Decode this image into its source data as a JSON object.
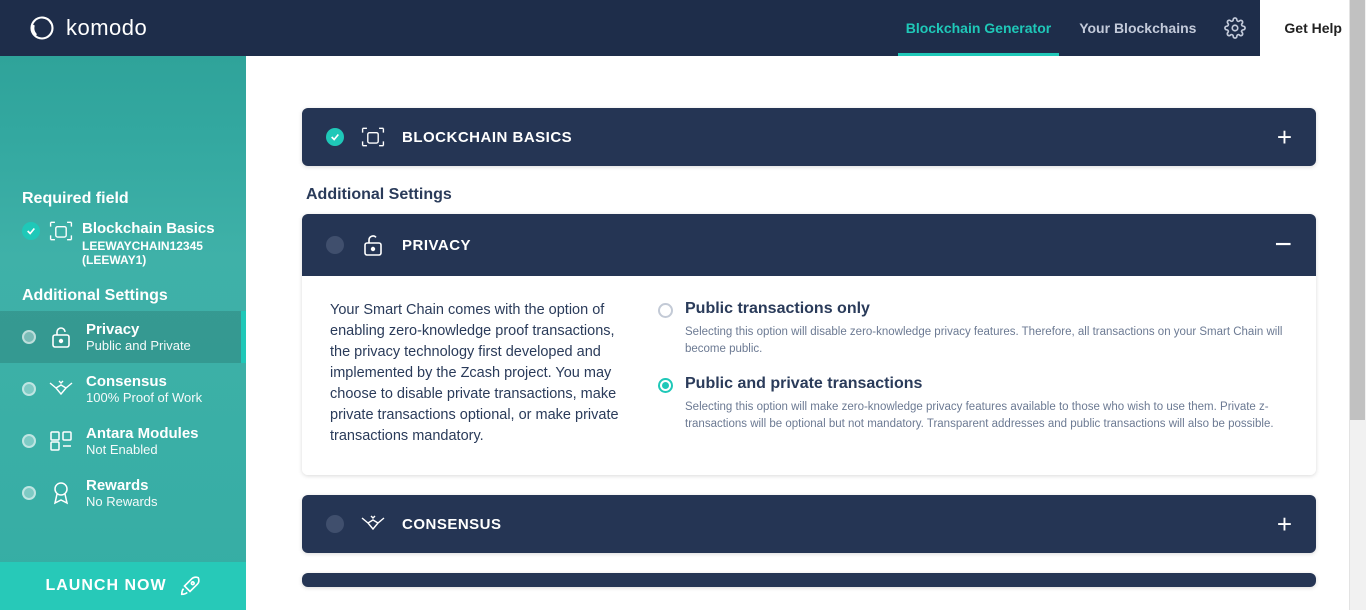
{
  "brand": "komodo",
  "topnav": {
    "generator": "Blockchain Generator",
    "your": "Your Blockchains",
    "help": "Get Help"
  },
  "sidebar": {
    "required_label": "Required field",
    "basics": {
      "title": "Blockchain Basics",
      "subtitle": "LEEWAYCHAIN12345 (LEEWAY1)"
    },
    "additional_label": "Additional Settings",
    "items": [
      {
        "title": "Privacy",
        "subtitle": "Public and Private"
      },
      {
        "title": "Consensus",
        "subtitle": "100% Proof of Work"
      },
      {
        "title": "Antara Modules",
        "subtitle": "Not Enabled"
      },
      {
        "title": "Rewards",
        "subtitle": "No Rewards"
      }
    ],
    "launch": "LAUNCH NOW"
  },
  "accordions": {
    "basics_title": "BLOCKCHAIN BASICS",
    "additional_label": "Additional Settings",
    "privacy": {
      "title": "PRIVACY",
      "description": "Your Smart Chain comes with the option of enabling zero-knowledge proof transactions, the privacy technology first developed and implemented by the Zcash project. You may choose to disable private transactions, make private transactions optional, or make private transactions mandatory.",
      "options": [
        {
          "title": "Public transactions only",
          "desc": "Selecting this option will disable zero-knowledge privacy features. Therefore, all transactions on your Smart Chain will become public."
        },
        {
          "title": "Public and private transactions",
          "desc": "Selecting this option will make zero-knowledge privacy features available to those who wish to use them. Private z-transactions will be optional but not mandatory. Transparent addresses and public transactions will also be possible."
        }
      ]
    },
    "consensus_title": "CONSENSUS"
  }
}
